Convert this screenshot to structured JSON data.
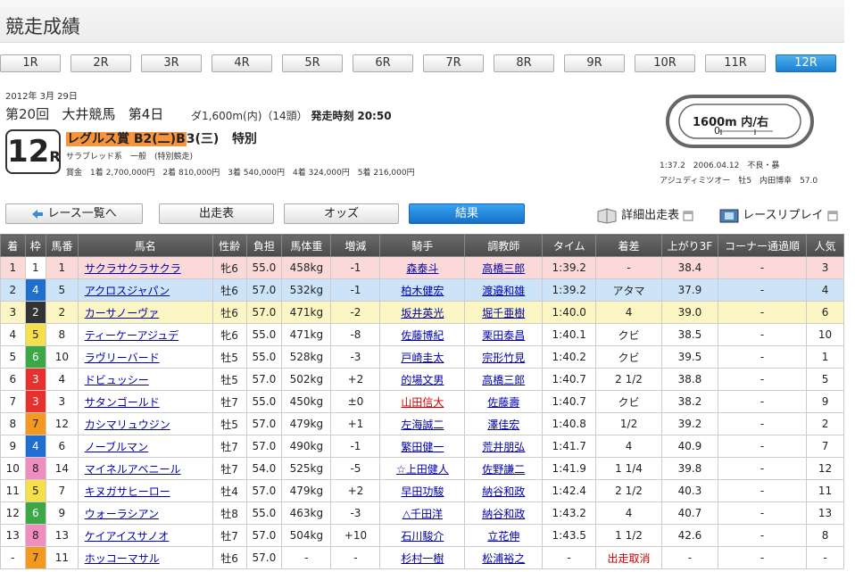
{
  "page_title": "競走成績",
  "race_tabs": [
    {
      "label": "1R",
      "active": false
    },
    {
      "label": "2R",
      "active": false
    },
    {
      "label": "3R",
      "active": false
    },
    {
      "label": "4R",
      "active": false
    },
    {
      "label": "5R",
      "active": false
    },
    {
      "label": "6R",
      "active": false
    },
    {
      "label": "7R",
      "active": false
    },
    {
      "label": "8R",
      "active": false
    },
    {
      "label": "9R",
      "active": false
    },
    {
      "label": "10R",
      "active": false
    },
    {
      "label": "11R",
      "active": false
    },
    {
      "label": "12R",
      "active": true
    }
  ],
  "race": {
    "date": "2012年 3月 29日",
    "kai": "第20回",
    "venue": "大井競馬",
    "day": "第4日",
    "course": "ダ1,600m(内)（14頭）",
    "post_label": "発走時刻",
    "post_time": "20:50",
    "number": "12",
    "number_suffix": "R",
    "name_highlight": "レグルス賞 B2(二)B",
    "name_rest": "3(三)",
    "grade": "特別",
    "conditions": "サラブレッド系　一般　(特別競走)",
    "prize": "賞金　1着 2,700,000円　2着 810,000円　3着 540,000円　4着 324,000円　5着 216,000円",
    "track_label": "1600m 内/右",
    "track_marker": "0",
    "record_line1": "1:37.2　2006.04.12　不良・暴",
    "record_line2": "アジュディミツオー　牡5　内田博幸　57.0"
  },
  "actions": {
    "back": "レース一覧へ",
    "entries": "出走表",
    "odds": "オッズ",
    "results": "結果",
    "detail": "詳細出走表",
    "replay": "レースリプレイ"
  },
  "table": {
    "headers": [
      "着",
      "枠",
      "馬番",
      "馬名",
      "性齢",
      "負担",
      "馬体重",
      "増減",
      "騎手",
      "調教師",
      "タイム",
      "着差",
      "上がり3F",
      "コーナー通過順",
      "人気"
    ],
    "waku_colors": {
      "1": {
        "bg": "#ffffff",
        "fg": "#222222"
      },
      "2": {
        "bg": "#333333",
        "fg": "#ffffff"
      },
      "3": {
        "bg": "#e8312f",
        "fg": "#ffffff"
      },
      "4": {
        "bg": "#1f6fd0",
        "fg": "#ffffff"
      },
      "5": {
        "bg": "#f5e04a",
        "fg": "#222222"
      },
      "6": {
        "bg": "#3aa844",
        "fg": "#ffffff"
      },
      "7": {
        "bg": "#f39a1e",
        "fg": "#222222"
      },
      "8": {
        "bg": "#f28dbf",
        "fg": "#222222"
      }
    },
    "rows": [
      {
        "pos": "1",
        "waku": "1",
        "num": "1",
        "horse": "サクラサクラサクラ",
        "sexage": "牝6",
        "weight": "55.0",
        "body": "458kg",
        "diff": "-1",
        "jockey": "森泰斗",
        "trainer": "高橋三郎",
        "time": "1:39.2",
        "margin": "-",
        "last3f": "38.4",
        "corner": "-",
        "pop": "3",
        "jockey_red": false,
        "margin_red": false
      },
      {
        "pos": "2",
        "waku": "4",
        "num": "5",
        "horse": "アクロスジャパン",
        "sexage": "牡6",
        "weight": "57.0",
        "body": "532kg",
        "diff": "-1",
        "jockey": "柏木健宏",
        "trainer": "渡邉和雄",
        "time": "1:39.2",
        "margin": "アタマ",
        "last3f": "37.9",
        "corner": "-",
        "pop": "4",
        "jockey_red": false,
        "margin_red": false
      },
      {
        "pos": "3",
        "waku": "2",
        "num": "2",
        "horse": "カーサノーヴァ",
        "sexage": "牡6",
        "weight": "57.0",
        "body": "471kg",
        "diff": "-2",
        "jockey": "坂井英光",
        "trainer": "堀千亜樹",
        "time": "1:40.0",
        "margin": "4",
        "last3f": "39.0",
        "corner": "-",
        "pop": "6",
        "jockey_red": false,
        "margin_red": false
      },
      {
        "pos": "4",
        "waku": "5",
        "num": "8",
        "horse": "ティーケーアジュデ",
        "sexage": "牝6",
        "weight": "55.0",
        "body": "471kg",
        "diff": "-8",
        "jockey": "佐藤博紀",
        "trainer": "栗田泰昌",
        "time": "1:40.1",
        "margin": "クビ",
        "last3f": "38.5",
        "corner": "-",
        "pop": "10",
        "jockey_red": false,
        "margin_red": false
      },
      {
        "pos": "5",
        "waku": "6",
        "num": "10",
        "horse": "ラヴリーバード",
        "sexage": "牡5",
        "weight": "55.0",
        "body": "528kg",
        "diff": "-3",
        "jockey": "戸崎圭太",
        "trainer": "宗形竹見",
        "time": "1:40.2",
        "margin": "クビ",
        "last3f": "39.5",
        "corner": "-",
        "pop": "1",
        "jockey_red": false,
        "margin_red": false
      },
      {
        "pos": "6",
        "waku": "3",
        "num": "4",
        "horse": "ドビュッシー",
        "sexage": "牡5",
        "weight": "57.0",
        "body": "502kg",
        "diff": "+2",
        "jockey": "的場文男",
        "trainer": "高橋三郎",
        "time": "1:40.7",
        "margin": "2 1/2",
        "last3f": "38.8",
        "corner": "-",
        "pop": "5",
        "jockey_red": false,
        "margin_red": false
      },
      {
        "pos": "7",
        "waku": "3",
        "num": "3",
        "horse": "サタンゴールド",
        "sexage": "牡7",
        "weight": "55.0",
        "body": "450kg",
        "diff": "±0",
        "jockey": "山田信大",
        "trainer": "佐藤壽",
        "time": "1:40.7",
        "margin": "クビ",
        "last3f": "38.2",
        "corner": "-",
        "pop": "9",
        "jockey_red": true,
        "margin_red": false
      },
      {
        "pos": "8",
        "waku": "7",
        "num": "12",
        "horse": "カシマリュウジン",
        "sexage": "牡5",
        "weight": "57.0",
        "body": "479kg",
        "diff": "+1",
        "jockey": "左海誠二",
        "trainer": "澤佳宏",
        "time": "1:40.8",
        "margin": "1/2",
        "last3f": "39.2",
        "corner": "-",
        "pop": "2",
        "jockey_red": false,
        "margin_red": false
      },
      {
        "pos": "9",
        "waku": "4",
        "num": "6",
        "horse": "ノーブルマン",
        "sexage": "牡7",
        "weight": "57.0",
        "body": "490kg",
        "diff": "-1",
        "jockey": "繁田健一",
        "trainer": "荒井朋弘",
        "time": "1:41.7",
        "margin": "4",
        "last3f": "40.9",
        "corner": "-",
        "pop": "7",
        "jockey_red": false,
        "margin_red": false
      },
      {
        "pos": "10",
        "waku": "8",
        "num": "14",
        "horse": "マイネルアベニール",
        "sexage": "牡7",
        "weight": "54.0",
        "body": "525kg",
        "diff": "-5",
        "jockey": "☆上田健人",
        "trainer": "佐野謙二",
        "time": "1:41.9",
        "margin": "1 1/4",
        "last3f": "39.8",
        "corner": "-",
        "pop": "12",
        "jockey_red": false,
        "margin_red": false
      },
      {
        "pos": "11",
        "waku": "5",
        "num": "7",
        "horse": "キヌガサヒーロー",
        "sexage": "牡4",
        "weight": "57.0",
        "body": "479kg",
        "diff": "+2",
        "jockey": "早田功駿",
        "trainer": "納谷和政",
        "time": "1:42.4",
        "margin": "2 1/2",
        "last3f": "40.3",
        "corner": "-",
        "pop": "11",
        "jockey_red": false,
        "margin_red": false
      },
      {
        "pos": "12",
        "waku": "6",
        "num": "9",
        "horse": "ウォーラシアン",
        "sexage": "牡8",
        "weight": "55.0",
        "body": "463kg",
        "diff": "-3",
        "jockey": "△千田洋",
        "trainer": "納谷和政",
        "time": "1:43.2",
        "margin": "4",
        "last3f": "40.7",
        "corner": "-",
        "pop": "13",
        "jockey_red": false,
        "margin_red": false
      },
      {
        "pos": "13",
        "waku": "8",
        "num": "13",
        "horse": "ケイアイスサノオ",
        "sexage": "牡7",
        "weight": "57.0",
        "body": "504kg",
        "diff": "+10",
        "jockey": "石川駿介",
        "trainer": "立花伸",
        "time": "1:43.5",
        "margin": "1 1/2",
        "last3f": "42.6",
        "corner": "-",
        "pop": "8",
        "jockey_red": false,
        "margin_red": false
      },
      {
        "pos": "-",
        "waku": "7",
        "num": "11",
        "horse": "ホッコーマサル",
        "sexage": "牡6",
        "weight": "57.0",
        "body": "-",
        "diff": "-",
        "jockey": "杉村一樹",
        "trainer": "松浦裕之",
        "time": "-",
        "margin": "出走取消",
        "last3f": "-",
        "corner": "-",
        "pop": "-",
        "jockey_red": false,
        "margin_red": true
      }
    ]
  }
}
